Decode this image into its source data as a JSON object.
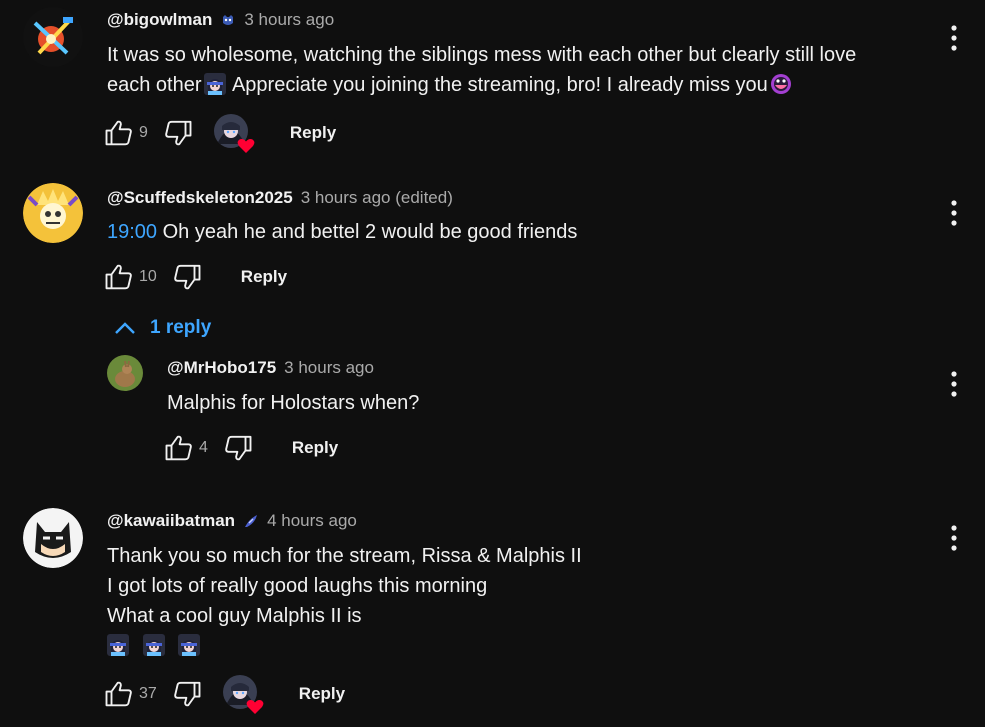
{
  "comments": [
    {
      "author": "@bigowlman",
      "time": "3 hours ago",
      "lines": [
        "It was so wholesome, watching the siblings mess with each other but clearly still love",
        "each other",
        " Appreciate you joining the streaming, bro! I already miss you"
      ],
      "likes": "9",
      "reply_label": "Reply",
      "badge_icon": "member-badge-icon",
      "creator_hearted": true
    },
    {
      "author": "@Scuffedskeleton2025",
      "time": "3 hours ago (edited)",
      "timestamp": "19:00",
      "text": " Oh yeah he and bettel 2 would be good friends",
      "likes": "10",
      "reply_label": "Reply",
      "creator_hearted": false,
      "replies_toggle": "1 reply"
    },
    {
      "author": "@MrHobo175",
      "time": "3 hours ago",
      "text": "Malphis for Holostars when?",
      "likes": "4",
      "reply_label": "Reply",
      "creator_hearted": false
    },
    {
      "author": "@kawaiibatman",
      "time": "4 hours ago",
      "lines": [
        "Thank you so much for the stream, Rissa & Malphis II",
        "I got lots of really good laughs this morning",
        "What a cool guy Malphis II is"
      ],
      "likes": "37",
      "reply_label": "Reply",
      "badge_icon": "member-badge-icon",
      "creator_hearted": true
    }
  ],
  "colors": {
    "background": "#0f0f0f",
    "text": "#f1f1f1",
    "secondary": "#aaaaaa",
    "link": "#3ea6ff",
    "heart": "#ff0033"
  }
}
